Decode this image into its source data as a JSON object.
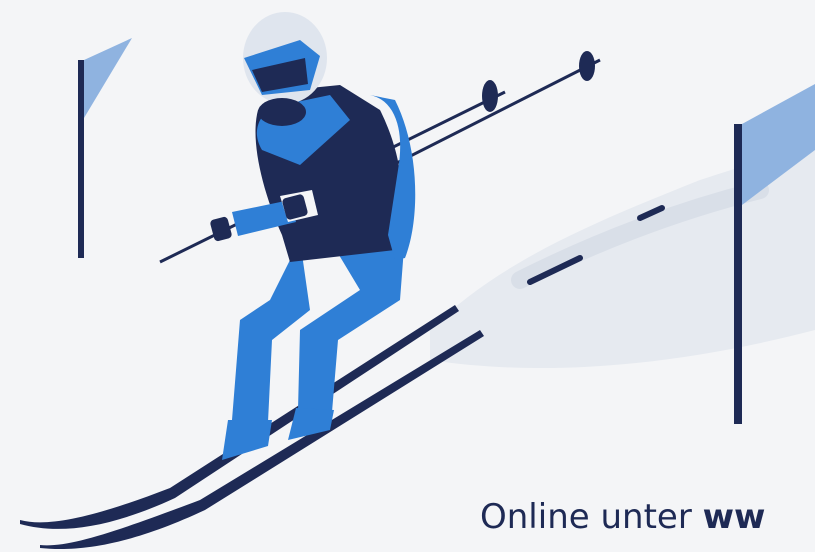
{
  "caption": {
    "text": "Online unter",
    "bold": "ww"
  },
  "colors": {
    "navy": "#1e2a55",
    "blue": "#2f7fd6",
    "light_blue": "#8fb3e0",
    "helmet": "#dfe5ee",
    "snow": "#eef1f5"
  }
}
